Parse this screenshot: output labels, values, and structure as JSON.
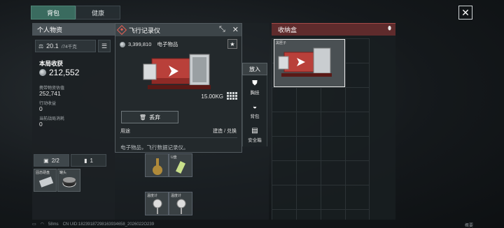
{
  "tabs": [
    {
      "label": "背包",
      "active": true
    },
    {
      "label": "健康",
      "active": false
    }
  ],
  "left_panel": {
    "title": "个人物资",
    "weight": {
      "value": "20.1",
      "capacity": "/74千克"
    },
    "earnings_title": "本局收获",
    "earnings_value": "212,552",
    "stats": [
      {
        "label": "携带物资估值",
        "value": "252,741"
      },
      {
        "label": "行动收益",
        "value": "0"
      },
      {
        "label": "当前战局消耗",
        "value": "0"
      }
    ],
    "equip_tabs": [
      {
        "label": "2/2",
        "icon": "case-icon"
      },
      {
        "label": "1",
        "icon": "battery-icon"
      }
    ],
    "slots": [
      {
        "label": "固态硬盘"
      },
      {
        "label": "罐头"
      }
    ]
  },
  "middle_grid": {
    "cells": [
      {
        "label": ""
      },
      {
        "label": ""
      },
      {
        "label": "U盘"
      },
      {
        "label": "温度计"
      },
      {
        "label": "温度计"
      }
    ]
  },
  "popup": {
    "title": "飞行记录仪",
    "price": "3,399,810",
    "category": "电子物品",
    "weight": "15.00KG",
    "discard_label": "丢弃",
    "use_label": "用途",
    "build_label": "建造 / 兑换",
    "description": "电子物品，飞行数据记录仪。",
    "accent_color": "#e06055"
  },
  "actions": {
    "put_label": "放入",
    "items": [
      {
        "label": "胸挂",
        "icon": "vest-icon"
      },
      {
        "label": "背包",
        "icon": "backpack-icon"
      },
      {
        "label": "安全箱",
        "icon": "safebox-icon"
      }
    ]
  },
  "right_panel": {
    "title": "收纳盒",
    "stored_item_label": "黑匣子",
    "header_color": "#5f2b2c"
  },
  "status_bar": {
    "ping": "58ms",
    "uid": "CN UID:18239187298163934658_2026022O239",
    "corner": "概要"
  }
}
